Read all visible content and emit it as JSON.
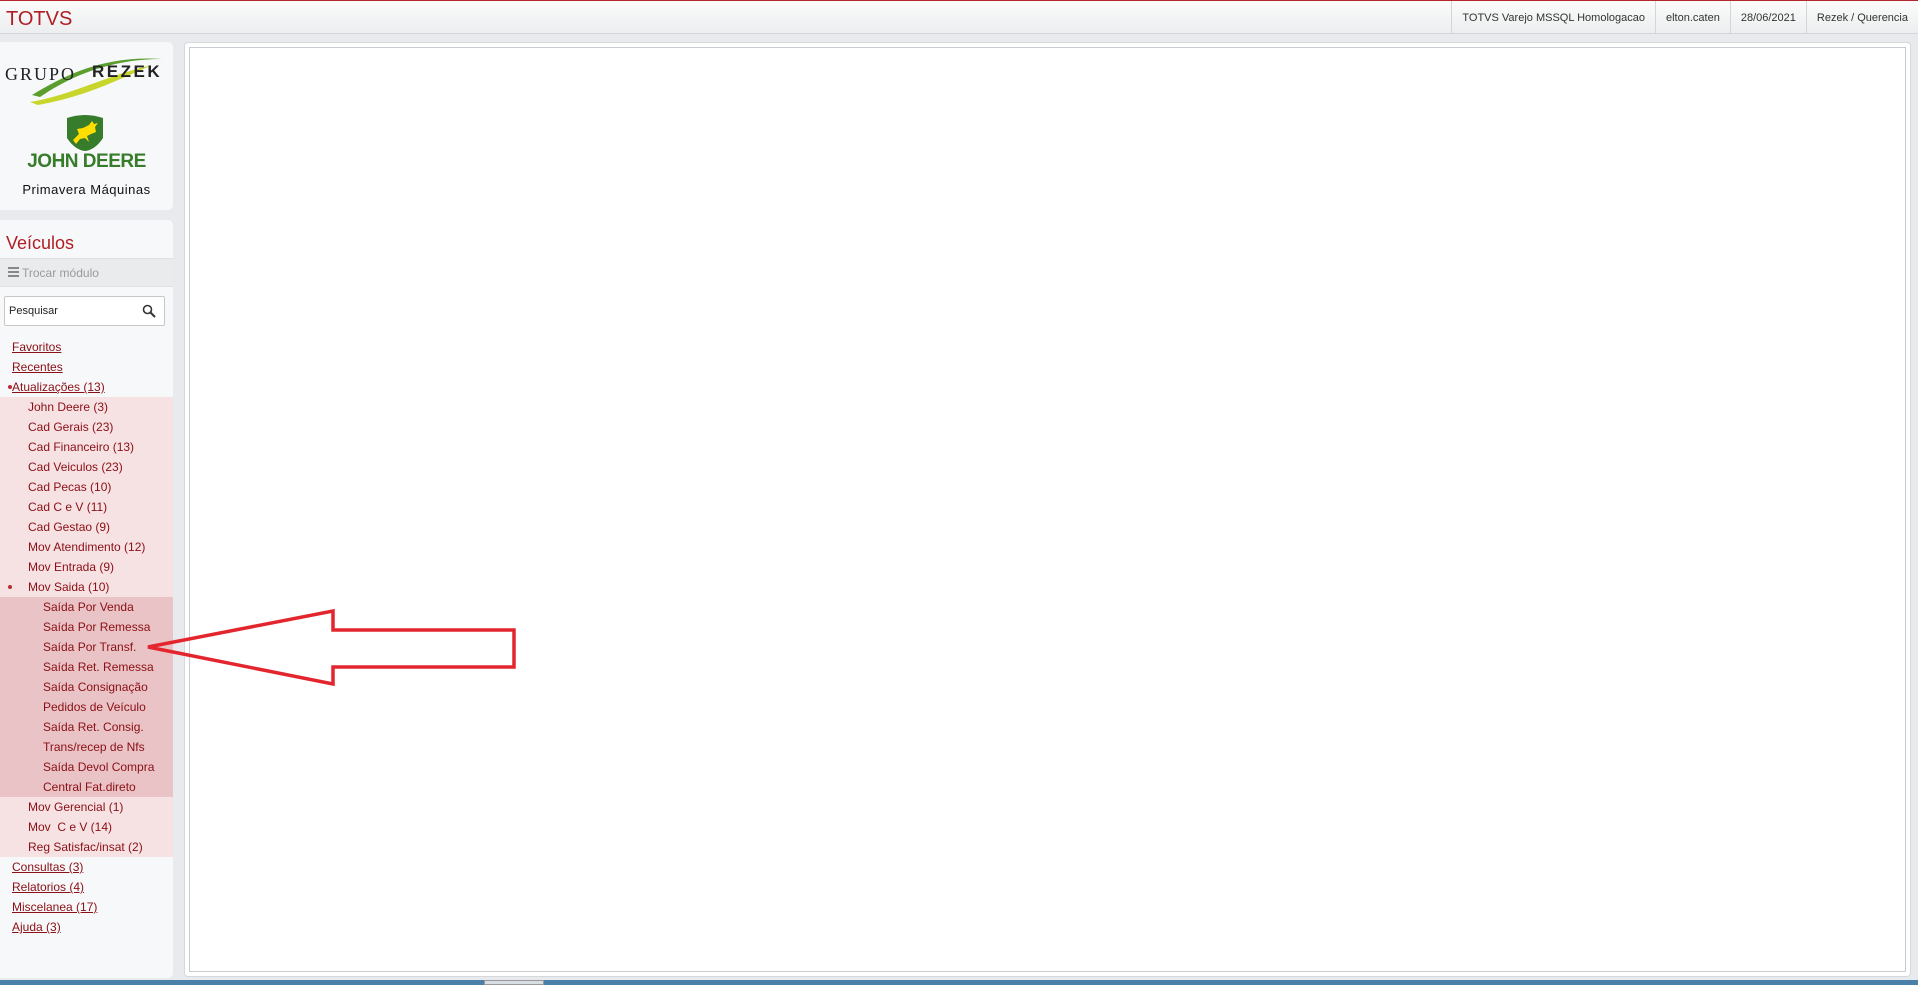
{
  "app": {
    "brand": "TOTVS"
  },
  "header": {
    "environment": "TOTVS Varejo MSSQL Homologacao",
    "user": "elton.caten",
    "date": "28/06/2021",
    "company": "Rezek / Querencia"
  },
  "logo": {
    "grupo": "GRUPO",
    "rezek": "REZEK",
    "brand": "JOHN DEERE",
    "dealer": "Primavera Máquinas"
  },
  "sidebar": {
    "module": "Veículos",
    "switch_module": "Trocar módulo",
    "search_placeholder": "Pesquisar",
    "top": [
      {
        "label": "Favoritos"
      },
      {
        "label": "Recentes"
      },
      {
        "label": "Atualizações (13)"
      }
    ],
    "atualizacoes": [
      {
        "label": "John Deere (3)"
      },
      {
        "label": "Cad Gerais (23)"
      },
      {
        "label": "Cad Financeiro (13)"
      },
      {
        "label": "Cad Veiculos (23)"
      },
      {
        "label": "Cad Pecas (10)"
      },
      {
        "label": "Cad C e V (11)"
      },
      {
        "label": "Cad Gestao (9)"
      },
      {
        "label": "Mov Atendimento (12)"
      },
      {
        "label": "Mov Entrada (9)"
      },
      {
        "label": "Mov Saida (10)"
      }
    ],
    "mov_saida": [
      {
        "label": "Saída Por Venda"
      },
      {
        "label": "Saída Por Remessa"
      },
      {
        "label": "Saída Por Transf."
      },
      {
        "label": "Saída Ret. Remessa"
      },
      {
        "label": "Saída Consignação"
      },
      {
        "label": "Pedidos de Veículo"
      },
      {
        "label": "Saída Ret. Consig."
      },
      {
        "label": "Trans/recep de Nfs"
      },
      {
        "label": "Saída Devol Compra"
      },
      {
        "label": "Central Fat.direto"
      }
    ],
    "atualizacoes_after": [
      {
        "label": "Mov Gerencial (1)"
      },
      {
        "label": "Mov  C e V (14)"
      },
      {
        "label": "Reg Satisfac/insat (2)"
      }
    ],
    "bottom": [
      {
        "label": "Consultas (3)"
      },
      {
        "label": "Relatorios (4)"
      },
      {
        "label": "Miscelanea (17)"
      },
      {
        "label": "Ajuda (3)"
      }
    ]
  },
  "colors": {
    "brand_red": "#b01e25",
    "menu_text": "#8a0f16",
    "submenu_bg": "#f6e2e3",
    "submenu_selected_bg": "#e9c3c5",
    "jd_green": "#367c2b",
    "annotation_arrow": "#e3262e"
  }
}
